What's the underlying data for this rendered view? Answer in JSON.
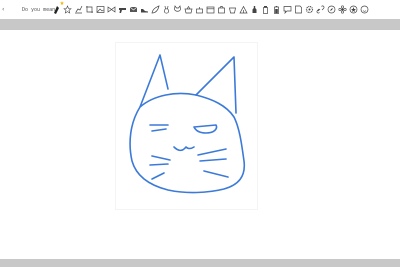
{
  "toolbar": {
    "suggest_label": "Do you mean:",
    "suggestions": [
      {
        "icon": "pen-icon"
      },
      {
        "icon": "star-icon"
      },
      {
        "icon": "chart-icon"
      },
      {
        "icon": "crop-icon"
      },
      {
        "icon": "image-icon"
      },
      {
        "icon": "bowtie-icon"
      },
      {
        "icon": "gun-icon"
      },
      {
        "icon": "mail-icon"
      },
      {
        "icon": "shoe-icon"
      },
      {
        "icon": "leaf-icon"
      },
      {
        "icon": "rabbit-icon"
      },
      {
        "icon": "cat-icon"
      },
      {
        "icon": "basket-icon"
      },
      {
        "icon": "cake-icon"
      },
      {
        "icon": "calendar-icon"
      },
      {
        "icon": "bag-icon"
      },
      {
        "icon": "bucket-icon"
      },
      {
        "icon": "tent-icon"
      },
      {
        "icon": "bottle-icon"
      },
      {
        "icon": "jar-icon"
      },
      {
        "icon": "battery-icon"
      },
      {
        "icon": "chat-icon"
      },
      {
        "icon": "paper-icon"
      },
      {
        "icon": "gear-icon"
      },
      {
        "icon": "link-icon"
      },
      {
        "icon": "compass-icon"
      },
      {
        "icon": "flower-icon"
      },
      {
        "icon": "badge-icon"
      },
      {
        "icon": "smile-icon"
      }
    ]
  },
  "colors": {
    "stroke": "#3b7ad9",
    "chrome": "#c8c8c8",
    "star": "#f4b400"
  }
}
